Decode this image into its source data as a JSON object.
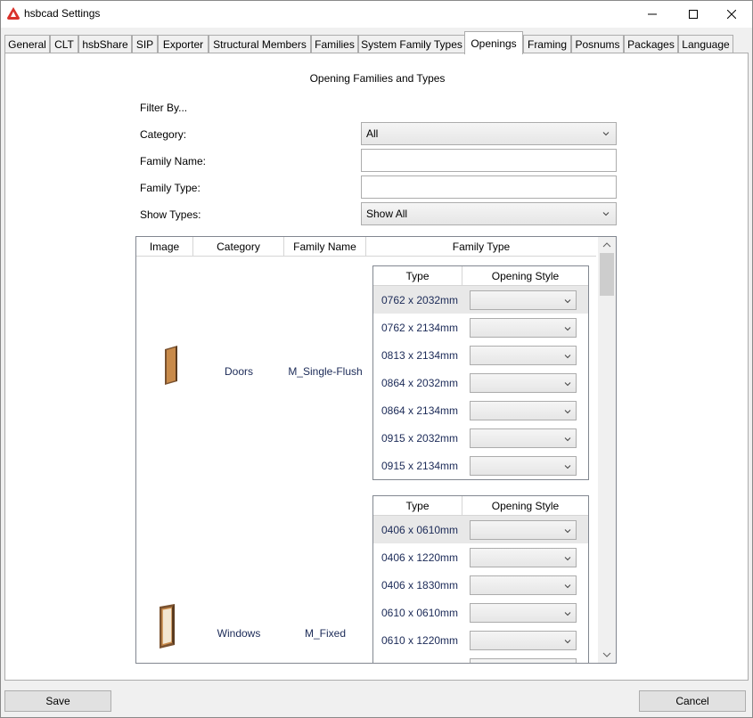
{
  "window": {
    "title": "hsbcad Settings"
  },
  "tabs": [
    {
      "label": "General"
    },
    {
      "label": "CLT"
    },
    {
      "label": "hsbShare"
    },
    {
      "label": "SIP"
    },
    {
      "label": "Exporter"
    },
    {
      "label": "Structural Members"
    },
    {
      "label": "Families"
    },
    {
      "label": "System Family Types"
    },
    {
      "label": "Openings",
      "active": true
    },
    {
      "label": "Framing"
    },
    {
      "label": "Posnums"
    },
    {
      "label": "Packages"
    },
    {
      "label": "Language"
    }
  ],
  "openings": {
    "section_title": "Opening Families and Types",
    "filter_by_label": "Filter By...",
    "category_label": "Category:",
    "category_value": "All",
    "family_name_label": "Family Name:",
    "family_name_value": "",
    "family_type_label": "Family Type:",
    "family_type_value": "",
    "show_types_label": "Show Types:",
    "show_types_value": "Show All"
  },
  "grid": {
    "columns": [
      "Image",
      "Category",
      "Family Name",
      "Family Type"
    ],
    "inner_columns": [
      "Type",
      "Opening Style"
    ],
    "rows": [
      {
        "category": "Doors",
        "family_name": "M_Single-Flush",
        "image_icon": "door-icon",
        "types": [
          "0762 x 2032mm",
          "0762 x 2134mm",
          "0813 x 2134mm",
          "0864 x 2032mm",
          "0864 x 2134mm",
          "0915 x 2032mm",
          "0915 x 2134mm"
        ],
        "opening_styles": [
          "",
          "",
          "",
          "",
          "",
          "",
          ""
        ]
      },
      {
        "category": "Windows",
        "family_name": "M_Fixed",
        "image_icon": "window-icon",
        "types": [
          "0406 x 0610mm",
          "0406 x 1220mm",
          "0406 x 1830mm",
          "0610 x 0610mm",
          "0610 x 1220mm"
        ],
        "opening_styles": [
          "",
          "",
          "",
          "",
          ""
        ]
      }
    ]
  },
  "footer": {
    "save_label": "Save",
    "cancel_label": "Cancel"
  },
  "colors": {
    "link_text": "#1b2a57",
    "selected_row": "#e8e8e8",
    "app_icon_red": "#d9322b"
  }
}
